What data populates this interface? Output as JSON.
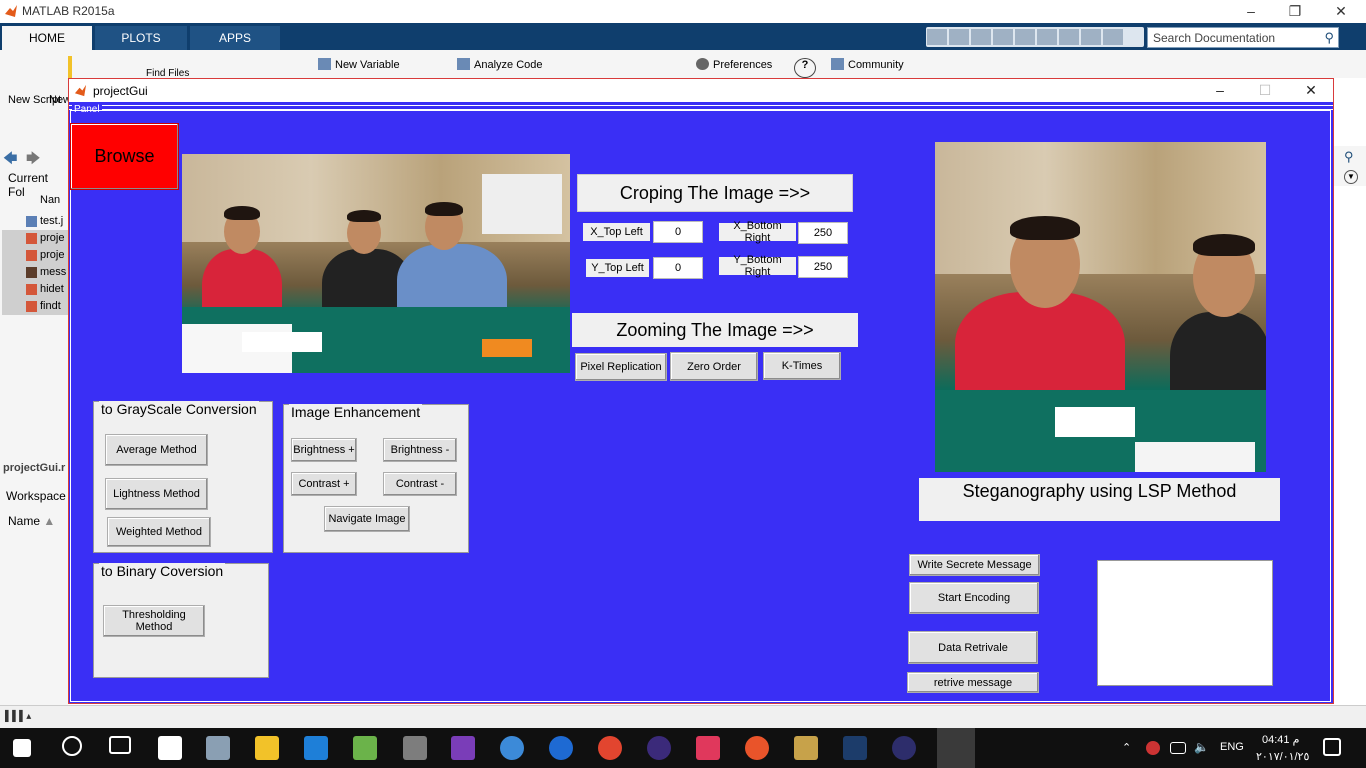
{
  "matlab": {
    "title": "MATLAB R2015a",
    "tabs": [
      "HOME",
      "PLOTS",
      "APPS"
    ],
    "search_placeholder": "Search Documentation",
    "ribbon": {
      "new_variable": "New Variable",
      "analyze_code": "Analyze Code",
      "preferences": "Preferences",
      "community": "Community",
      "new_script": "New Script",
      "new": "New",
      "find_files": "Find Files"
    },
    "left_panel": {
      "current_folder": "Current Fol",
      "name_header": "Nan",
      "files": [
        "test.j",
        "proje",
        "proje",
        "mess",
        "hidet",
        "findt"
      ],
      "selected_file": "projectGui.r",
      "workspace": "Workspace",
      "workspace_name": "Name"
    }
  },
  "gui": {
    "title": "projectGui",
    "panel_label": "Panel",
    "browse": "Browse",
    "crop_title": "Croping The Image =>>",
    "x_top_left_label": "X_Top Left",
    "x_top_left_value": "0",
    "y_top_left_label": "Y_Top Left",
    "y_top_left_value": "0",
    "x_bottom_right_label": "X_Bottom Right",
    "x_bottom_right_value": "250",
    "y_bottom_right_label": "Y_Bottom Right",
    "y_bottom_right_value": "250",
    "zoom_title": "Zooming The Image =>>",
    "pixel_replication": "Pixel Replication",
    "zero_order": "Zero Order",
    "k_times": "K-Times",
    "grayscale_group": "to GrayScale Conversion",
    "average_method": "Average Method",
    "lightness_method": "Lightness Method",
    "weighted_method": "Weighted Method",
    "binary_group": "to Binary Coversion",
    "thresholding_method": "Thresholding Method",
    "enhance_group": "Image Enhancement",
    "brightness_plus": "Brightness +",
    "brightness_minus": "Brightness -",
    "contrast_plus": "Contrast +",
    "contrast_minus": "Contrast -",
    "navigate_image": "Navigate Image",
    "stego_title": "Steganography using LSP Method",
    "write_message": "Write Secrete Message",
    "start_encoding": "Start Encoding",
    "data_retrival": "Data Retrivale",
    "retrive_message": "retrive message"
  },
  "taskbar": {
    "language": "ENG",
    "time": "04:41 م",
    "date": "٢٠١٧/٠١/٢٥"
  },
  "colors": {
    "panel_bg": "#3a2ff5",
    "browse_bg": "#ff0000",
    "ribbon_tabs_bg": "#0f3e6d"
  }
}
